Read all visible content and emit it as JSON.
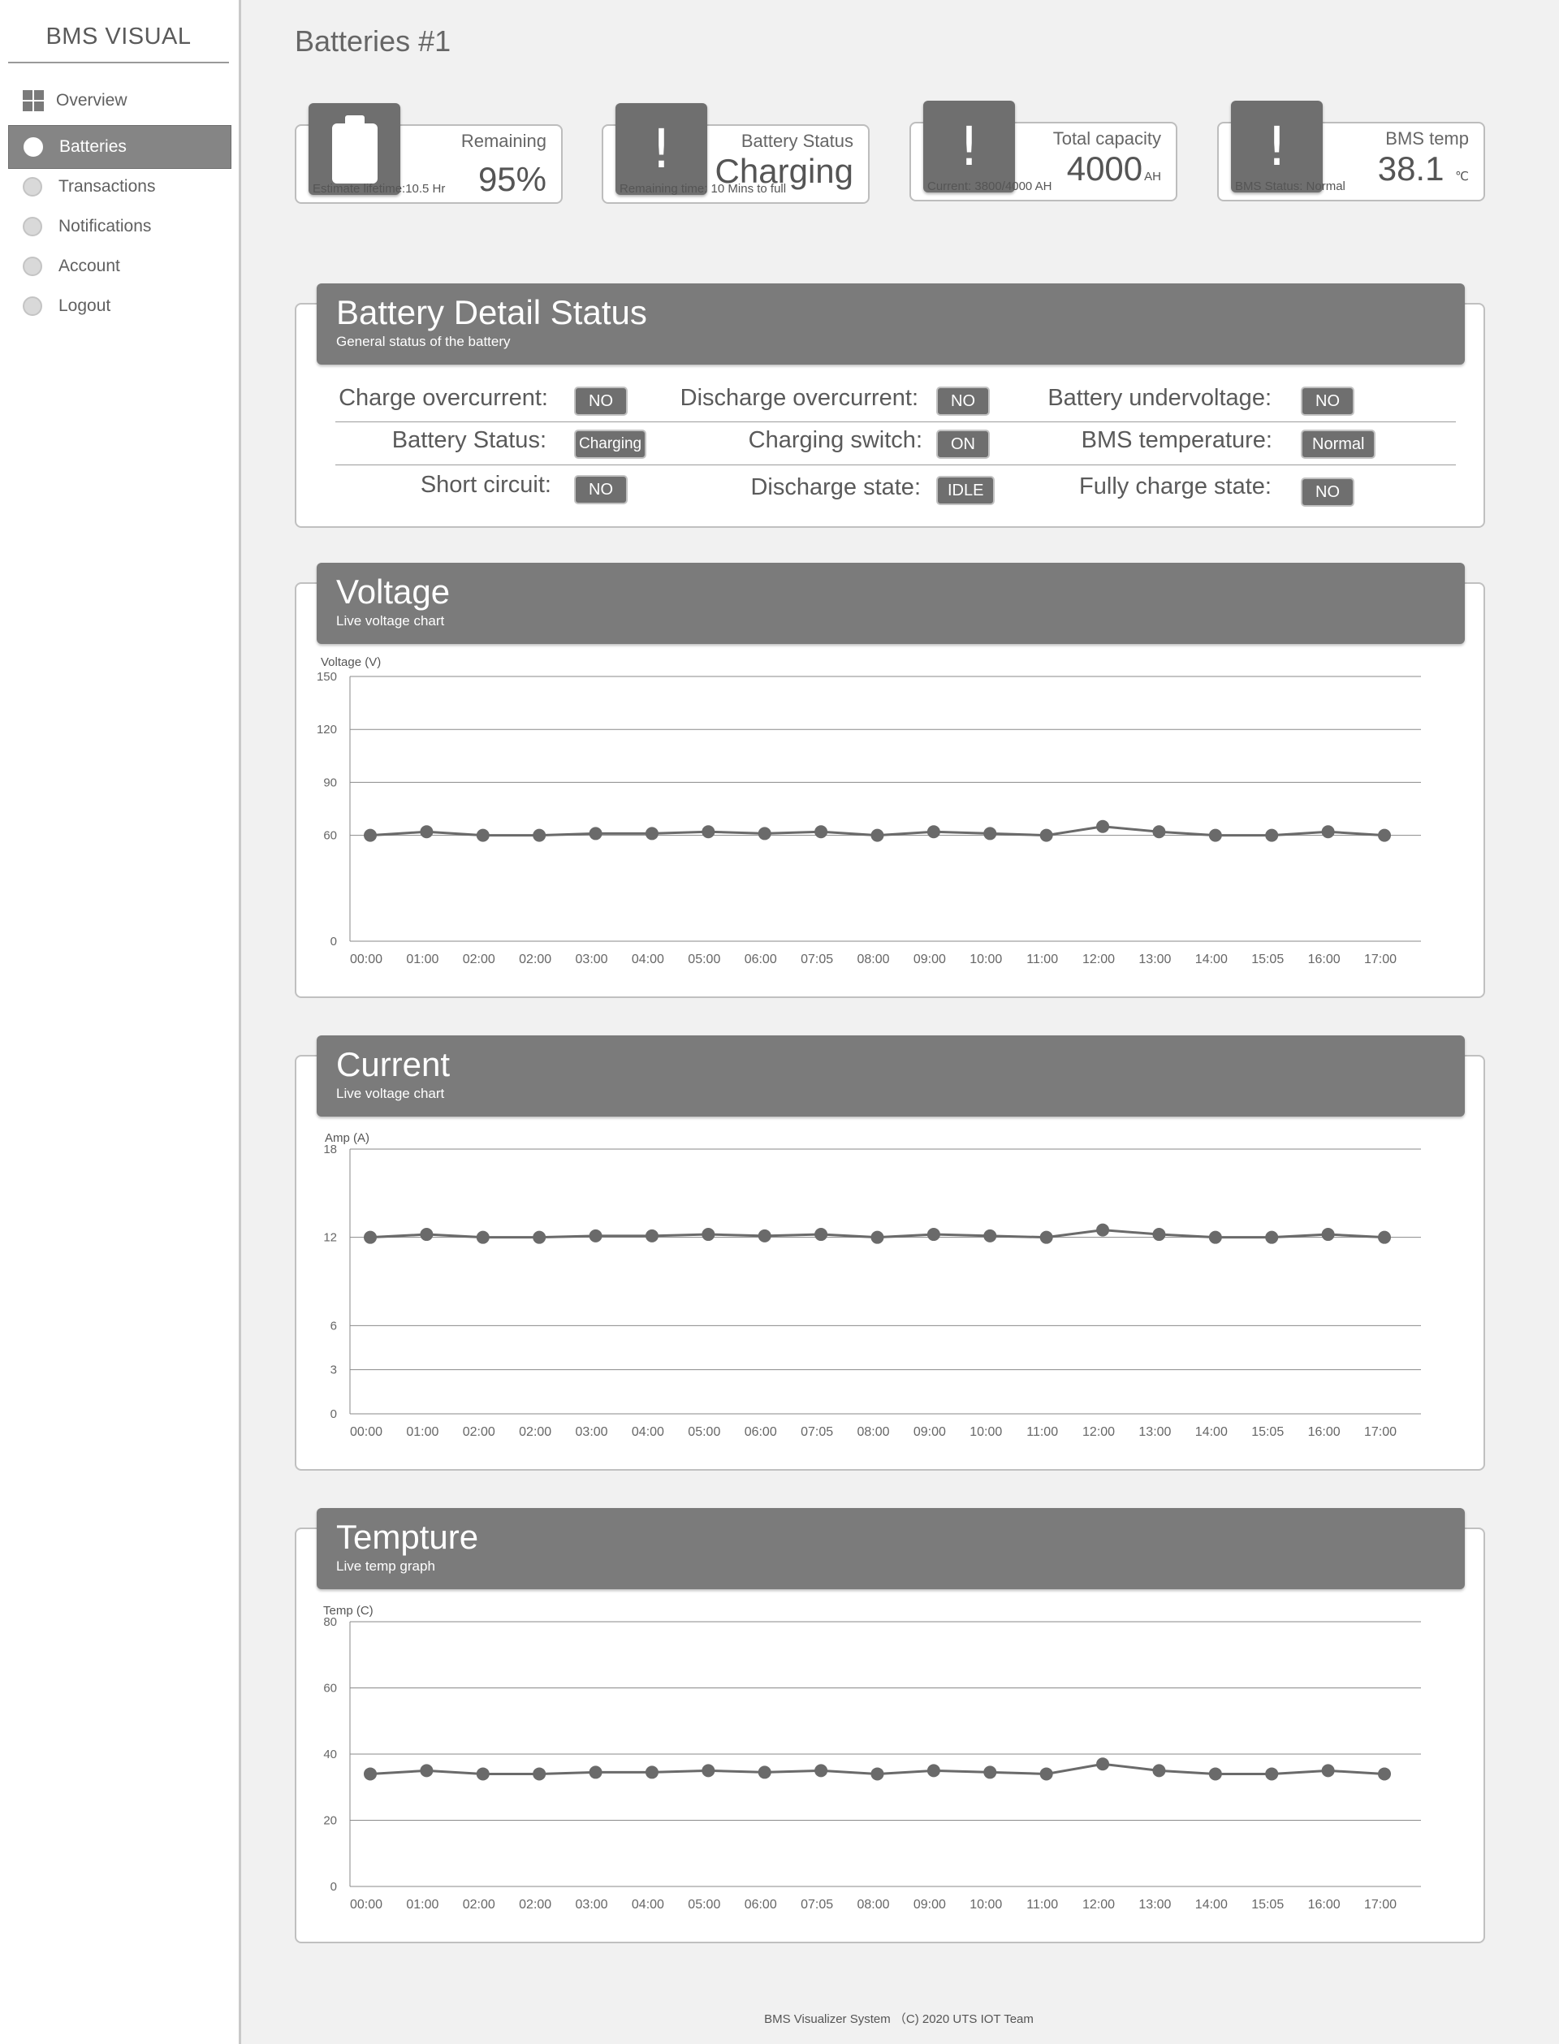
{
  "sidebar": {
    "brand": "BMS VISUAL",
    "items": [
      {
        "label": "Overview"
      },
      {
        "label": "Batteries"
      },
      {
        "label": "Transactions"
      },
      {
        "label": "Notifications"
      },
      {
        "label": "Account"
      },
      {
        "label": "Logout"
      }
    ]
  },
  "page_title": "Batteries #1",
  "cards": {
    "remaining": {
      "label": "Remaining",
      "value": "95%",
      "foot": "Estimate lifetime:10.5 Hr"
    },
    "status": {
      "label": "Battery Status",
      "value": "Charging",
      "foot": "Remaining time: 10 Mins to full"
    },
    "capacity": {
      "label": "Total capacity",
      "value": "4000",
      "unit": "AH",
      "foot": "Current: 3800/4000 AH"
    },
    "temp": {
      "label": "BMS temp",
      "value": "38.1",
      "unit": "℃",
      "foot": "BMS Status: Normal"
    }
  },
  "detail": {
    "title": "Battery Detail Status",
    "subtitle": "General status of the battery",
    "items": [
      {
        "label": "Charge overcurrent:",
        "value": "NO"
      },
      {
        "label": "Discharge overcurrent:",
        "value": "NO"
      },
      {
        "label": "Battery undervoltage:",
        "value": "NO"
      },
      {
        "label": "Battery Status:",
        "value": "Charging"
      },
      {
        "label": "Charging switch:",
        "value": "ON"
      },
      {
        "label": "BMS temperature:",
        "value": "Normal"
      },
      {
        "label": "Short circuit:",
        "value": "NO"
      },
      {
        "label": "Discharge state:",
        "value": "IDLE"
      },
      {
        "label": "Fully charge state:",
        "value": "NO"
      }
    ]
  },
  "chart_data": [
    {
      "type": "line",
      "title": "Voltage",
      "subtitle": "Live voltage chart",
      "ylabel": "Voltage (V)",
      "yticks": [
        0,
        60,
        90,
        120,
        150
      ],
      "ylim": [
        0,
        150
      ],
      "categories": [
        "00:00",
        "01:00",
        "02:00",
        "02:00",
        "03:00",
        "04:00",
        "05:00",
        "06:00",
        "07:05",
        "08:00",
        "09:00",
        "10:00",
        "11:00",
        "12:00",
        "13:00",
        "14:00",
        "15:05",
        "16:00",
        "17:00"
      ],
      "series": [
        {
          "values": [
            60,
            62,
            60,
            60,
            61,
            61,
            62,
            61,
            62,
            60,
            62,
            61,
            60,
            65,
            62,
            60,
            60,
            62,
            60
          ]
        }
      ]
    },
    {
      "type": "line",
      "title": "Current",
      "subtitle": "Live voltage chart",
      "ylabel": "Amp (A)",
      "yticks": [
        0,
        3,
        6,
        12,
        18
      ],
      "ylim": [
        0,
        18
      ],
      "categories": [
        "00:00",
        "01:00",
        "02:00",
        "02:00",
        "03:00",
        "04:00",
        "05:00",
        "06:00",
        "07:05",
        "08:00",
        "09:00",
        "10:00",
        "11:00",
        "12:00",
        "13:00",
        "14:00",
        "15:05",
        "16:00",
        "17:00"
      ],
      "series": [
        {
          "values": [
            12,
            12.2,
            12,
            12,
            12.1,
            12.1,
            12.2,
            12.1,
            12.2,
            12,
            12.2,
            12.1,
            12,
            12.5,
            12.2,
            12,
            12,
            12.2,
            12
          ]
        }
      ]
    },
    {
      "type": "line",
      "title": "Tempture",
      "subtitle": "Live temp graph",
      "ylabel": "Temp (C)",
      "yticks": [
        0,
        20,
        40,
        60,
        80
      ],
      "ylim": [
        0,
        80
      ],
      "categories": [
        "00:00",
        "01:00",
        "02:00",
        "02:00",
        "03:00",
        "04:00",
        "05:00",
        "06:00",
        "07:05",
        "08:00",
        "09:00",
        "10:00",
        "11:00",
        "12:00",
        "13:00",
        "14:00",
        "15:05",
        "16:00",
        "17:00"
      ],
      "series": [
        {
          "values": [
            34,
            35,
            34,
            34,
            34.5,
            34.5,
            35,
            34.5,
            35,
            34,
            35,
            34.5,
            34,
            37,
            35,
            34,
            34,
            35,
            34
          ]
        }
      ]
    }
  ],
  "footer": "BMS Visualizer System （C) 2020 UTS IOT Team"
}
